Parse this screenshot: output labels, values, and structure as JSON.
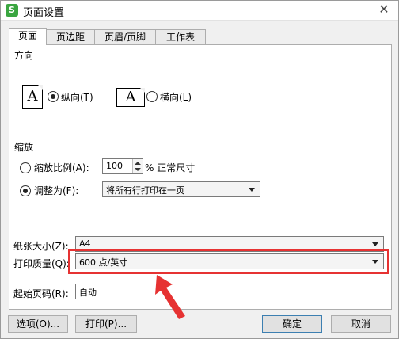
{
  "window": {
    "title": "页面设置",
    "app_icon_letter": "S",
    "close_glyph": "✕"
  },
  "tabs": [
    {
      "label": "页面",
      "active": true
    },
    {
      "label": "页边距",
      "active": false
    },
    {
      "label": "页眉/页脚",
      "active": false
    },
    {
      "label": "工作表",
      "active": false
    }
  ],
  "orientation": {
    "group_label": "方向",
    "portrait": {
      "icon_letter": "A",
      "label": "纵向(T)",
      "selected": true
    },
    "landscape": {
      "icon_letter": "A",
      "label": "横向(L)",
      "selected": false
    }
  },
  "scaling": {
    "group_label": "缩放",
    "scale_percent": {
      "label": "缩放比例(A):",
      "value": "100",
      "suffix": "% 正常尺寸",
      "selected": false
    },
    "fit_to": {
      "label": "调整为(F):",
      "value": "将所有行打印在一页",
      "selected": true
    }
  },
  "paper_size": {
    "label": "纸张大小(Z):",
    "value": "A4"
  },
  "print_quality": {
    "label": "打印质量(Q):",
    "value": "600 点/英寸"
  },
  "first_page": {
    "label": "起始页码(R):",
    "value": "自动"
  },
  "buttons": {
    "options": "选项(O)...",
    "print": "打印(P)...",
    "ok": "确定",
    "cancel": "取消"
  },
  "colors": {
    "highlight": "#e63232",
    "app_icon": "#3aa640",
    "primary_border": "#3c7fb1"
  }
}
